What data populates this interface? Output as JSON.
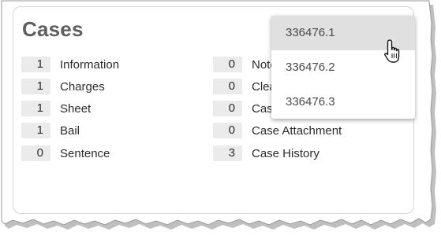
{
  "cases": {
    "title": "Cases",
    "left_column": [
      {
        "count": "1",
        "label": "Information"
      },
      {
        "count": "1",
        "label": "Charges"
      },
      {
        "count": "1",
        "label": "Sheet"
      },
      {
        "count": "1",
        "label": "Bail"
      },
      {
        "count": "0",
        "label": "Sentence"
      }
    ],
    "right_column": [
      {
        "count": "0",
        "label": "Note"
      },
      {
        "count": "0",
        "label": "Clea"
      },
      {
        "count": "0",
        "label": "Cas"
      },
      {
        "count": "0",
        "label": "Case Attachment"
      },
      {
        "count": "3",
        "label": "Case History"
      }
    ]
  },
  "dropdown": {
    "options": [
      "336476.1",
      "336476.2",
      "336476.3"
    ],
    "hovered_index": 0
  },
  "icons": {
    "cursor": "hand-pointer-icon"
  },
  "colors": {
    "count_bg": "#ebebeb",
    "hover_bg": "#e0e0e0",
    "title": "#5f5f5f"
  }
}
